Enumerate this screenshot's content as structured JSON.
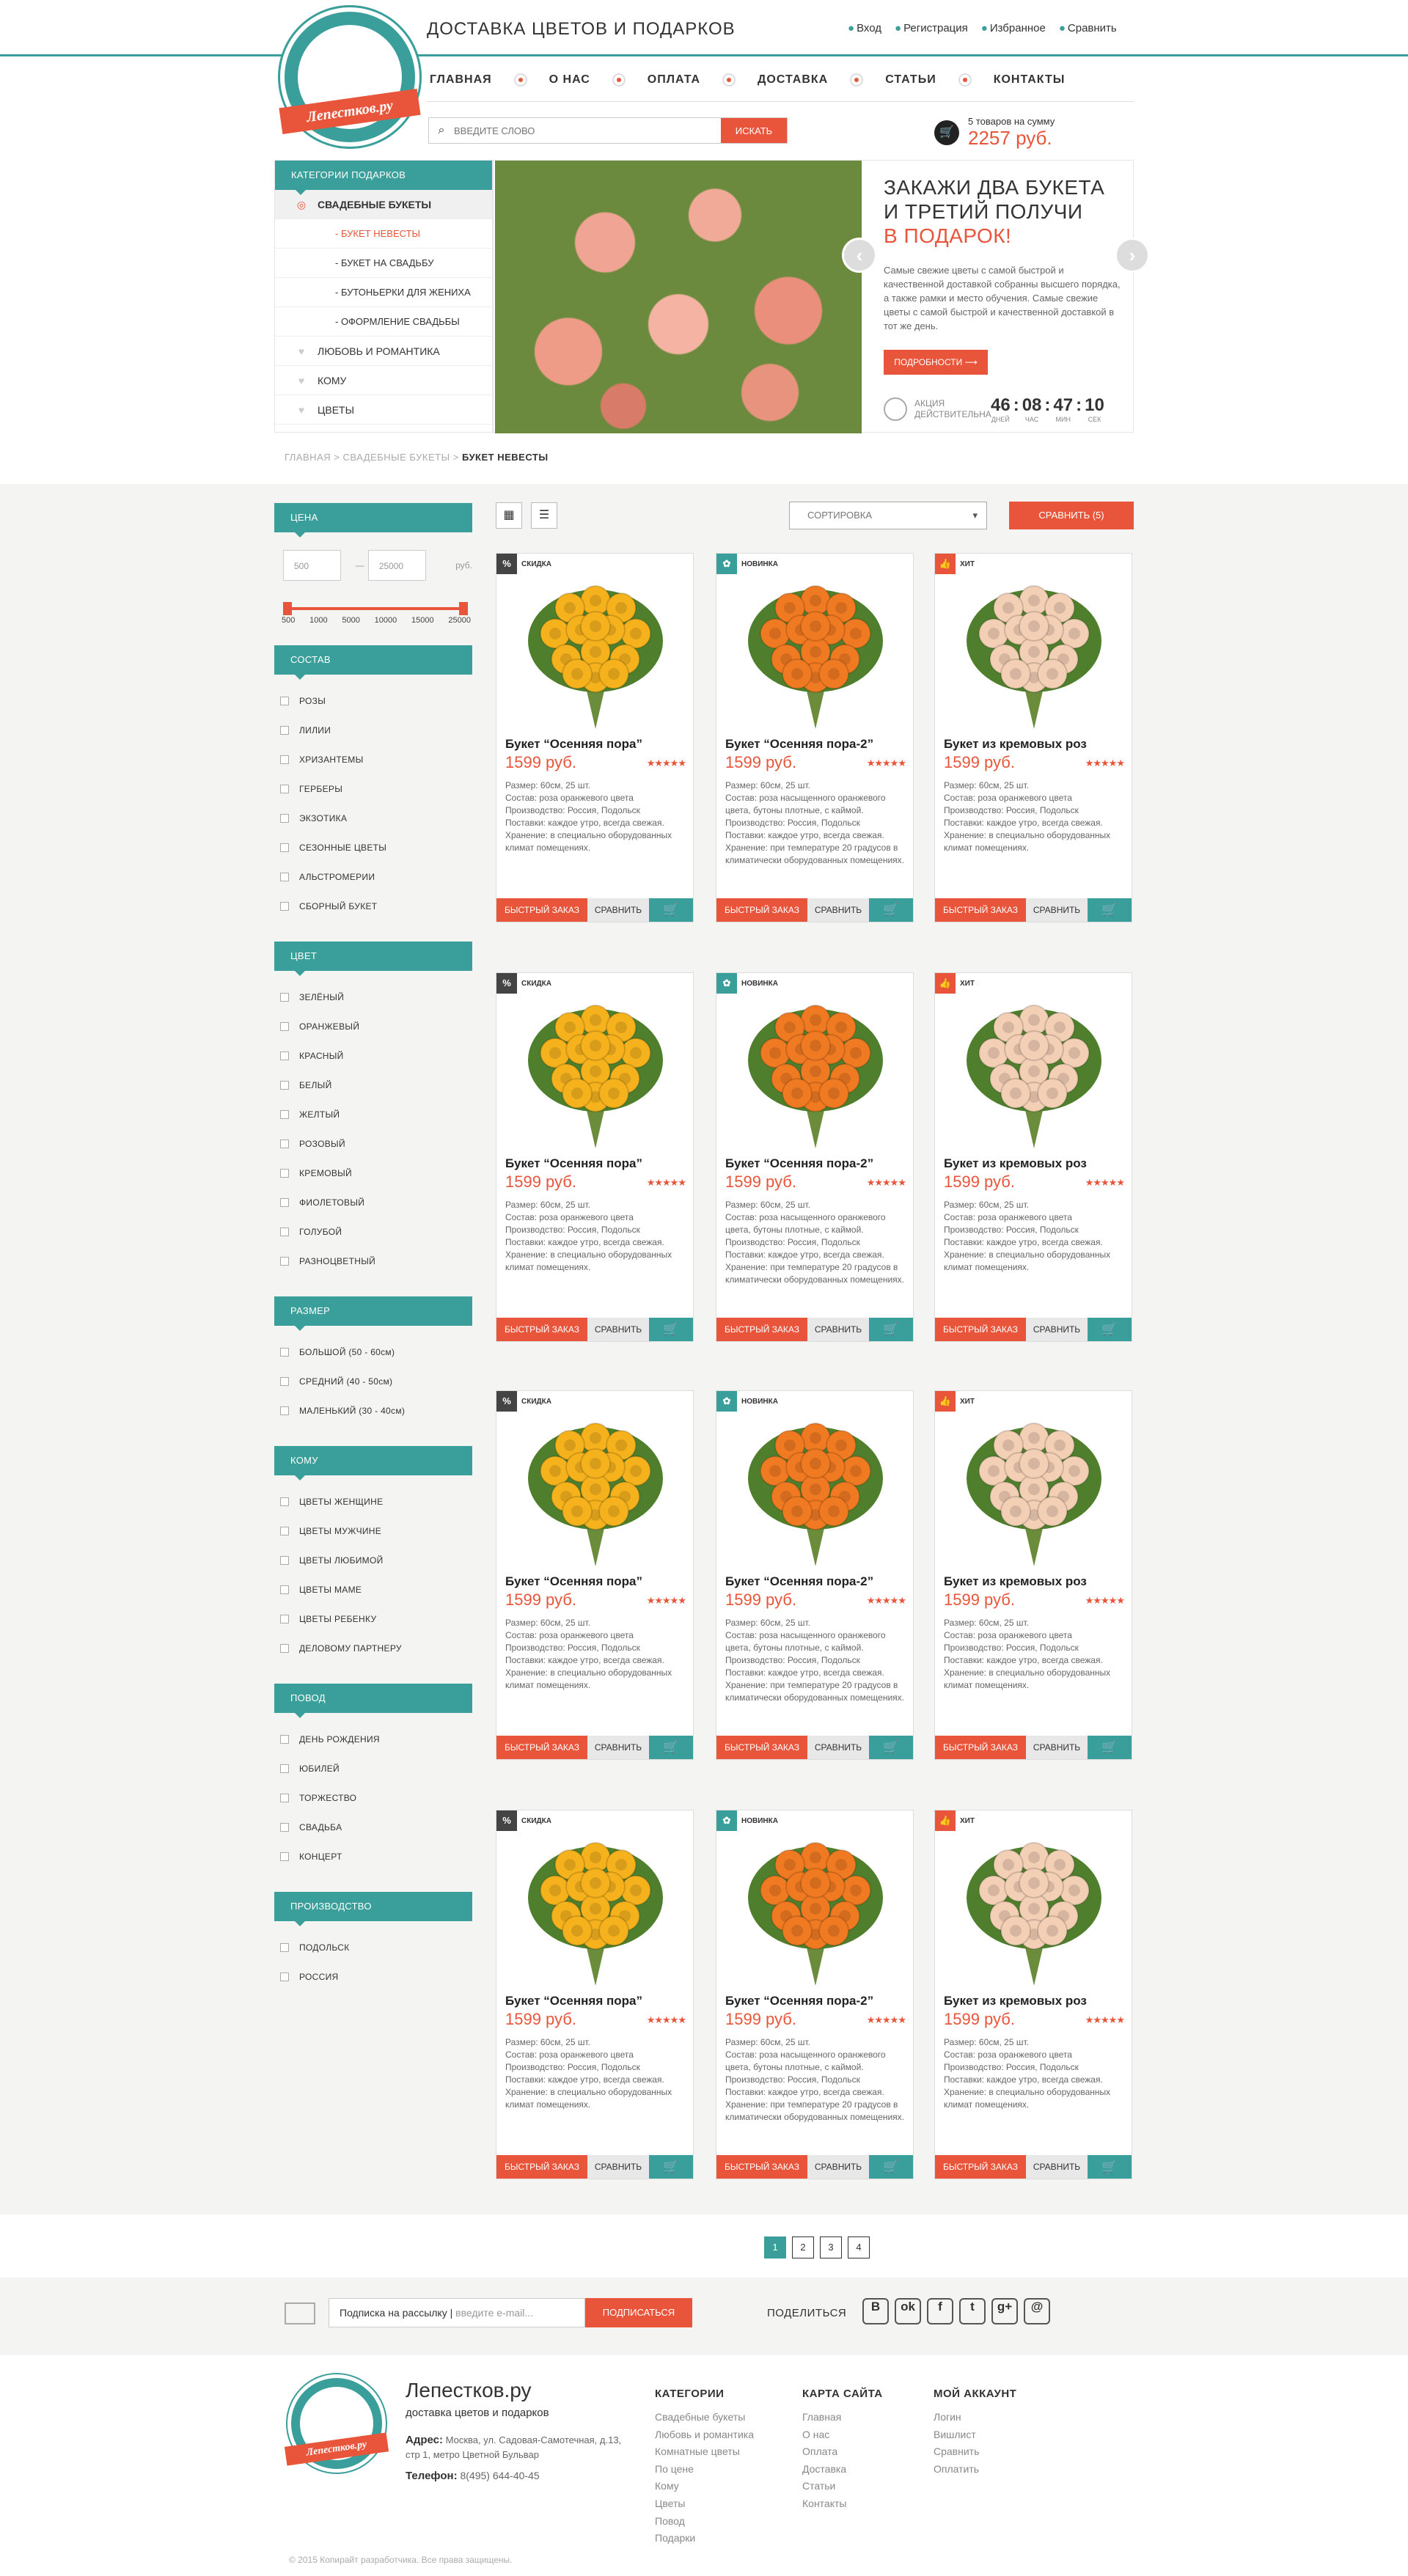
{
  "header": {
    "logo_text": "Лепестков.ру",
    "site_title": "ДОСТАВКА ЦВЕТОВ И ПОДАРКОВ",
    "top_links": [
      {
        "icon": "login-icon",
        "label": "Вход"
      },
      {
        "icon": "pencil-icon",
        "label": "Регистрация"
      },
      {
        "icon": "star-icon",
        "label": "Избранное"
      },
      {
        "icon": "compare-icon",
        "label": "Сравнить"
      }
    ],
    "nav": [
      "ГЛАВНАЯ",
      "О НАС",
      "ОПЛАТА",
      "ДОСТАВКА",
      "СТАТЬИ",
      "КОНТАКТЫ"
    ],
    "search": {
      "placeholder": "ВВЕДИТЕ СЛОВО",
      "button": "ИСКАТЬ"
    },
    "cart": {
      "count_text": "5 товаров на сумму",
      "total": "2257 руб."
    }
  },
  "catmenu": {
    "title": "КАТЕГОРИИ ПОДАРКОВ",
    "items": [
      {
        "label": "СВАДЕБНЫЕ БУКЕТЫ",
        "type": "active"
      },
      {
        "label": "- БУКЕТ НЕВЕСТЫ",
        "type": "sub-red"
      },
      {
        "label": "- БУКЕТ НА СВАДЬБУ",
        "type": "sub"
      },
      {
        "label": "- БУТОНЬЕРКИ ДЛЯ ЖЕНИХА",
        "type": "sub"
      },
      {
        "label": "- ОФОРМЛЕНИЕ СВАДЬБЫ",
        "type": "sub"
      },
      {
        "label": "ЛЮБОВЬ И РОМАНТИКА",
        "type": "main",
        "icon": "heart-icon"
      },
      {
        "label": "КОМУ",
        "type": "main",
        "icon": "person-icon"
      },
      {
        "label": "ЦВЕТЫ",
        "type": "main",
        "icon": "flower-icon"
      }
    ]
  },
  "slider": {
    "heading1": "ЗАКАЖИ ДВА БУКЕТА",
    "heading2": "И ТРЕТИЙ ПОЛУЧИ",
    "heading3": "В ПОДАРОК!",
    "text": "Самые свежие цветы с самой быстрой и качественной доставкой собранны высшего порядка, а также рамки и место обучения. Самые свежие цветы с самой быстрой и качественной доставкой в тот же день.",
    "more_button": "ПОДРОБНОСТИ ⟶",
    "timer_label": "АКЦИЯ ДЕЙСТВИТЕЛЬНА",
    "timer": [
      {
        "value": "46",
        "unit": "ДНЕЙ"
      },
      {
        "value": "08",
        "unit": "ЧАС"
      },
      {
        "value": "47",
        "unit": "МИН"
      },
      {
        "value": "10",
        "unit": "СЕК"
      }
    ]
  },
  "breadcrumb": {
    "home": "ГЛАВНАЯ",
    "sep": ">",
    "section": "СВАДЕБНЫЕ БУКЕТЫ",
    "current": "БУКЕТ НЕВЕСТЫ"
  },
  "filters": {
    "price": {
      "title": "ЦЕНА",
      "min": "500",
      "max": "25000",
      "dash": "—",
      "currency": "руб.",
      "ticks": [
        "500",
        "1000",
        "5000",
        "10000",
        "15000",
        "25000"
      ]
    },
    "groups": [
      {
        "title": "СОСТАВ",
        "options": [
          "РОЗЫ",
          "ЛИЛИИ",
          "ХРИЗАНТЕМЫ",
          "ГЕРБЕРЫ",
          "ЭКЗОТИКА",
          "СЕЗОННЫЕ ЦВЕТЫ",
          "АЛЬСТРОМЕРИИ",
          "СБОРНЫЙ БУКЕТ"
        ]
      },
      {
        "title": "ЦВЕТ",
        "options": [
          "ЗЕЛЁНЫЙ",
          "ОРАНЖЕВЫЙ",
          "КРАСНЫЙ",
          "БЕЛЫЙ",
          "ЖЕЛТЫЙ",
          "РОЗОВЫЙ",
          "КРЕМОВЫЙ",
          "ФИОЛЕТОВЫЙ",
          "ГОЛУБОЙ",
          "РАЗНОЦВЕТНЫЙ"
        ]
      },
      {
        "title": "РАЗМЕР",
        "options": [
          "БОЛЬШОЙ (50 - 60см)",
          "СРЕДНИЙ (40 - 50см)",
          "МАЛЕНЬКИЙ (30 - 40см)"
        ]
      },
      {
        "title": "КОМУ",
        "options": [
          "ЦВЕТЫ ЖЕНЩИНЕ",
          "ЦВЕТЫ МУЖЧИНЕ",
          "ЦВЕТЫ ЛЮБИМОЙ",
          "ЦВЕТЫ МАМЕ",
          "ЦВЕТЫ РЕБЕНКУ",
          "ДЕЛОВОМУ ПАРТНЕРУ"
        ]
      },
      {
        "title": "ПОВОД",
        "options": [
          "ДЕНЬ РОЖДЕНИЯ",
          "ЮБИЛЕЙ",
          "ТОРЖЕСТВО",
          "СВАДЬБА",
          "КОНЦЕРТ"
        ]
      },
      {
        "title": "ПРОИЗВОДСТВО",
        "options": [
          "ПОДОЛЬСК",
          "РОССИЯ"
        ]
      }
    ]
  },
  "toolbar": {
    "sort": "СОРТИРОВКА",
    "compare": "СРАВНИТЬ (5)"
  },
  "product_templates": [
    {
      "badge": "СКИДКА",
      "badge_icon": "percent-icon",
      "badge_color": "#444444",
      "title": "Букет “Осенняя пора”",
      "price": "1599 руб.",
      "stars": "★★★★★",
      "flower_color": "#f5b21d",
      "desc": [
        "Размер: 60см, 25 шт.",
        "Состав: роза оранжевого цвета",
        "Производство: Россия, Подольск",
        "Поставки: каждое утро, всегда свежая.",
        "Хранение: в специально оборудованных климат помещениях."
      ]
    },
    {
      "badge": "НОВИНКА",
      "badge_icon": "leaf-icon",
      "badge_color": "#3a9e9a",
      "title": "Букет “Осенняя пора-2”",
      "price": "1599 руб.",
      "stars": "★★★★★",
      "flower_color": "#f07a22",
      "desc": [
        "Размер: 60см, 25 шт.",
        "Состав: роза насыщенного оранжевого цвета, бутоны плотные, с каймой.",
        "Производство: Россия, Подольск",
        "Поставки: каждое утро, всегда свежая.",
        "Хранение: при температуре 20 градусов в климатически оборудованных помещениях."
      ]
    },
    {
      "badge": "ХИТ",
      "badge_icon": "thumbs-up-icon",
      "badge_color": "#e8553b",
      "title": "Букет из кремовых роз",
      "price": "1599 руб.",
      "stars": "★★★★★",
      "flower_color": "#f3cfb5",
      "desc": [
        "Размер: 60см, 25 шт.",
        "Состав: роза оранжевого цвета",
        "Производство: Россия, Подольск",
        "Поставки: каждое утро, всегда свежая.",
        "Хранение: в специально оборудованных климат помещениях."
      ]
    }
  ],
  "card_buttons": {
    "quick": "БЫСТРЫЙ ЗАКАЗ",
    "compare": "СРАВНИТЬ",
    "cart_icon": "cart-icon"
  },
  "pager": [
    "1",
    "2",
    "3",
    "4"
  ],
  "subscribe": {
    "label": "Подписка на рассылку",
    "sep": "|",
    "placeholder": "введите e-mail...",
    "button": "ПОДПИСАТЬСЯ",
    "share": "ПОДЕЛИТЬСЯ",
    "social": [
      "B",
      "ok",
      "f",
      "t",
      "g+",
      "@"
    ]
  },
  "footer": {
    "name": "Лепестков.ру",
    "tagline": "доставка цветов и подарков",
    "addr_label": "Адрес:",
    "addr": "Москва, ул. Садовая-Самотечная, д.13, стр 1, метро Цветной Бульвар",
    "phone_label": "Телефон:",
    "phone": "8(495) 644-40-45",
    "cols": [
      {
        "title": "КАТЕГОРИИ",
        "links": [
          "Свадебные букеты",
          "Любовь и романтика",
          "Комнатные цветы",
          "По цене",
          "Кому",
          "Цветы",
          "Повод",
          "Подарки"
        ]
      },
      {
        "title": "КАРТА САЙТА",
        "links": [
          "Главная",
          "О нас",
          "Оплата",
          "Доставка",
          "Статьи",
          "Контакты"
        ]
      },
      {
        "title": "МОЙ АККАУНТ",
        "links": [
          "Логин",
          "Вишлист",
          "Сравнить",
          "Оплатить"
        ]
      }
    ],
    "copyright": "© 2015 Копирайт разработчика. Все права защищены."
  },
  "colors": {
    "accent": "#3a9e9a",
    "brand_red": "#e8553b"
  }
}
